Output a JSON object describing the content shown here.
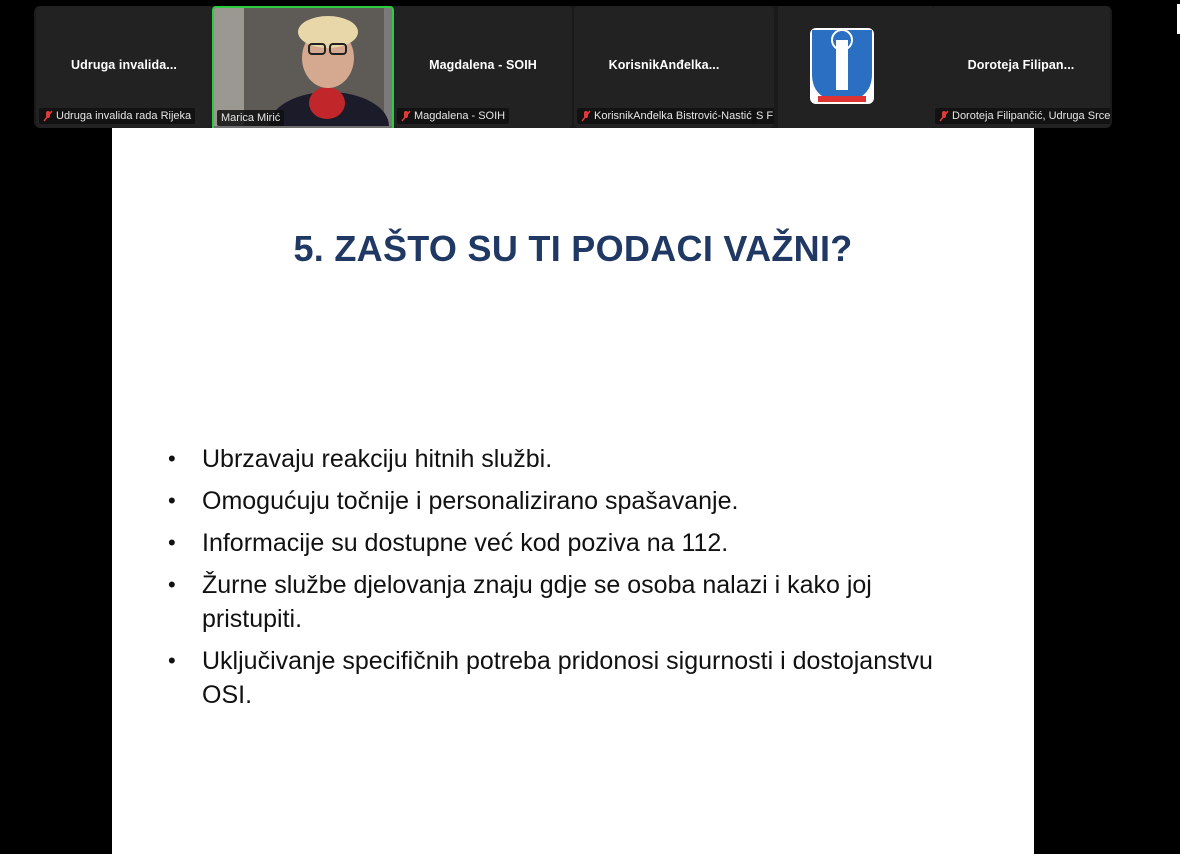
{
  "participants": [
    {
      "title": "Udruga  invalida...",
      "tag": "Udruga  invalida rada Rijeka",
      "muted": true
    },
    {
      "title": "",
      "tag": "Marica Mirić",
      "muted": false,
      "video": true
    },
    {
      "title": "Magdalena - SOIH",
      "tag": "Magdalena - SOIH",
      "muted": true
    },
    {
      "title": "KorisnikAnđelka...",
      "tag": "KorisnikAnđelka Bistrović-Nastić",
      "muted": true,
      "extra": "S F"
    },
    {
      "title": "",
      "tag": "",
      "muted": false,
      "logo": true
    },
    {
      "title": "Doroteja  Filipan...",
      "tag": "Doroteja Filipančić, Udruga Srce",
      "muted": true
    }
  ],
  "slide": {
    "title": "5. ZAŠTO SU TI PODACI VAŽNI?",
    "bullets": [
      "Ubrzavaju reakciju hitnih službi.",
      "Omogućuju točnije i personalizirano spašavanje.",
      "Informacije su dostupne već kod poziva na 112.",
      "Žurne službe djelovanja znaju gdje se osoba nalazi i kako joj pristupiti.",
      "Uključivanje specifičnih potreba pridonosi sigurnosti i dostojanstvu OSI."
    ]
  },
  "colors": {
    "title": "#1f3864",
    "muted_icon": "#e03b3b",
    "active_speaker": "#2ecc40"
  }
}
